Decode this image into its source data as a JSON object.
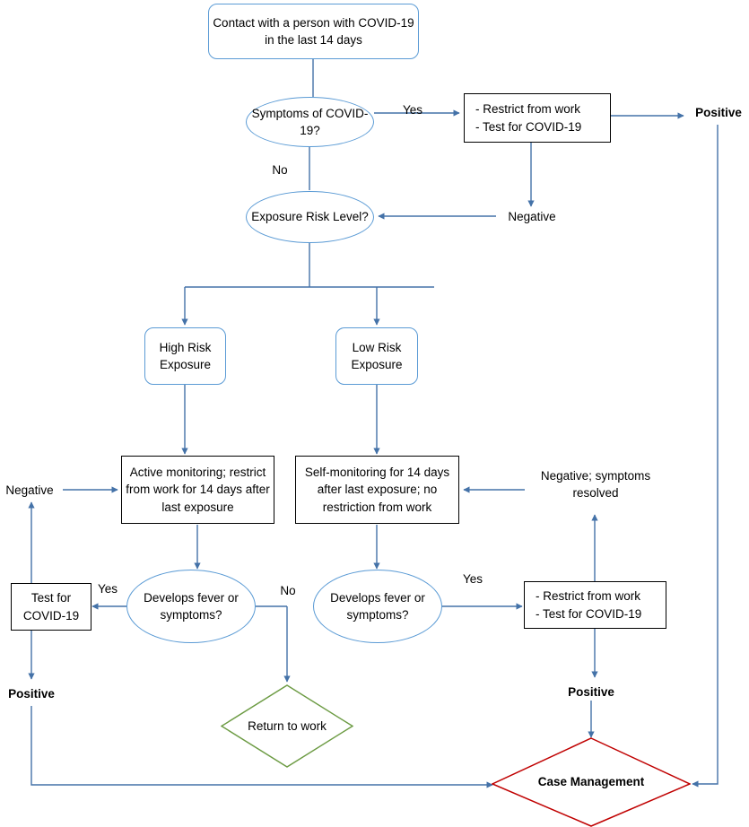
{
  "diagram": {
    "title": "COVID-19 exposure and return-to-work decision flowchart",
    "colors": {
      "connector": "#4472a8",
      "blue_outline": "#5b9bd5",
      "black_outline": "#000000",
      "green_outline": "#6c9b43",
      "red_outline": "#c00000",
      "text": "#000000",
      "background": "#ffffff"
    },
    "nodes": {
      "contact": {
        "label": "Contact with a person with COVID-19 in the last 14 days",
        "shape": "rounded-rectangle"
      },
      "symptoms_q": {
        "label": "Symptoms of COVID-19?",
        "shape": "ellipse"
      },
      "restrict_test_top": {
        "label": "- Restrict from work\n- Test for COVID-19",
        "shape": "rectangle"
      },
      "exposure_risk_q": {
        "label": "Exposure Risk Level?",
        "shape": "ellipse"
      },
      "high_risk": {
        "label": "High Risk Exposure",
        "shape": "rounded-rectangle"
      },
      "low_risk": {
        "label": "Low Risk Exposure",
        "shape": "rounded-rectangle"
      },
      "active_monitoring": {
        "label": "Active monitoring; restrict from work for 14 days after last exposure",
        "shape": "rectangle"
      },
      "self_monitoring": {
        "label": "Self-monitoring for 14 days after last exposure; no restriction from work",
        "shape": "rectangle"
      },
      "develops_left_q": {
        "label": "Develops fever or symptoms?",
        "shape": "ellipse"
      },
      "develops_right_q": {
        "label": "Develops fever or symptoms?",
        "shape": "ellipse"
      },
      "test_for_covid": {
        "label": "Test for COVID-19",
        "shape": "rectangle"
      },
      "restrict_test_bottom": {
        "label": "- Restrict from work\n- Test for COVID-19",
        "shape": "rectangle"
      },
      "return_to_work": {
        "label": "Return to work",
        "shape": "diamond"
      },
      "case_management": {
        "label": "Case Management",
        "shape": "diamond"
      }
    },
    "edge_labels": {
      "yes_top": "Yes",
      "no_top": "No",
      "negative_top_right": "Negative",
      "positive_top_right": "Positive",
      "negative_left": "Negative",
      "negative_symptoms_resolved": "Negative; symptoms resolved",
      "yes_left": "Yes",
      "no_middle": "No",
      "yes_right": "Yes",
      "positive_bottom_left": "Positive",
      "positive_bottom_right": "Positive"
    }
  }
}
